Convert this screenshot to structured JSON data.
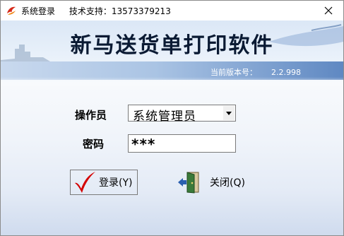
{
  "window": {
    "title": "系统登录",
    "support": "技术支持：13573379213"
  },
  "banner": {
    "title": "新马送货单打印软件",
    "version_label": "当前版本号：",
    "version": "2.2.998"
  },
  "form": {
    "operator_label": "操作员",
    "operator_value": "系统管理员",
    "password_label": "密码",
    "password_value": "***"
  },
  "buttons": {
    "login": "登录(Y)",
    "close": "关闭(Q)"
  },
  "colors": {
    "banner_title": "#0a1a33",
    "login_check": "#d40000",
    "door": "#3a7a3a"
  },
  "icons": [
    "app-logo-icon",
    "close-icon",
    "dropdown-arrow-icon",
    "checkmark-icon",
    "exit-door-icon"
  ]
}
